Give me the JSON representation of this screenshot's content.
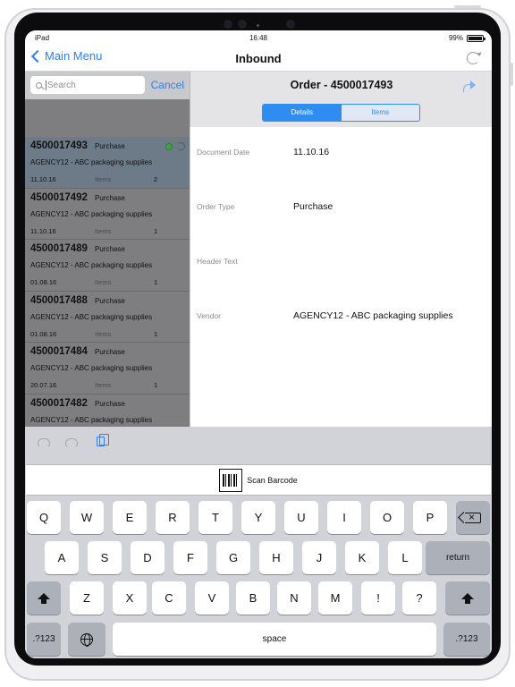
{
  "status_bar": {
    "device": "iPad",
    "time": "16:48",
    "battery": "99%"
  },
  "nav": {
    "back_label": "Main Menu",
    "title": "Inbound"
  },
  "search": {
    "placeholder": "Search",
    "cancel_label": "Cancel"
  },
  "orders": [
    {
      "number": "4500017493",
      "type": "Purchase",
      "vendor": "AGENCY12 - ABC packaging supplies",
      "date": "11.10.16",
      "items_label": "Items",
      "count": "2",
      "selected": true
    },
    {
      "number": "4500017492",
      "type": "Purchase",
      "vendor": "AGENCY12 - ABC packaging supplies",
      "date": "11.10.16",
      "items_label": "Items",
      "count": "1"
    },
    {
      "number": "4500017489",
      "type": "Purchase",
      "vendor": "AGENCY12 - ABC packaging supplies",
      "date": "01.08.16",
      "items_label": "Items",
      "count": "1"
    },
    {
      "number": "4500017488",
      "type": "Purchase",
      "vendor": "AGENCY12 - ABC packaging supplies",
      "date": "01.08.16",
      "items_label": "Items",
      "count": "1"
    },
    {
      "number": "4500017484",
      "type": "Purchase",
      "vendor": "AGENCY12 - ABC packaging supplies",
      "date": "20.07.16",
      "items_label": "Items",
      "count": "1"
    },
    {
      "number": "4500017482",
      "type": "Purchase",
      "vendor": "AGENCY12 - ABC packaging supplies",
      "date": "",
      "items_label": "",
      "count": ""
    }
  ],
  "detail": {
    "title": "Order - 4500017493",
    "tabs": [
      {
        "label": "Details",
        "active": true
      },
      {
        "label": "Items",
        "active": false
      }
    ],
    "fields": [
      {
        "label": "Document Date",
        "value": "11.10.16"
      },
      {
        "label": "Order Type",
        "value": "Purchase"
      },
      {
        "label": "Header Text",
        "value": ""
      },
      {
        "label": "Vendor",
        "value": "AGENCY12 - ABC packaging supplies"
      }
    ]
  },
  "keyboard": {
    "scan_label": "Scan Barcode",
    "row1": [
      "Q",
      "W",
      "E",
      "R",
      "T",
      "Y",
      "U",
      "I",
      "O",
      "P"
    ],
    "row2": [
      "A",
      "S",
      "D",
      "F",
      "G",
      "H",
      "J",
      "K",
      "L"
    ],
    "return_label": "return",
    "row3": [
      "Z",
      "X",
      "C",
      "V",
      "B",
      "N",
      "M",
      "!",
      "?"
    ],
    "numbers_label": ".?123",
    "space_label": "space"
  },
  "colors": {
    "accent": "#2f7ef6",
    "selected_row": "#6d7a87",
    "status_ok": "#3fa24a"
  },
  "icons": [
    "chevron-left-icon",
    "refresh-icon",
    "search-icon",
    "share-icon",
    "undo-icon",
    "redo-icon",
    "paste-icon",
    "barcode-icon",
    "shift-icon",
    "backspace-icon",
    "globe-icon"
  ]
}
